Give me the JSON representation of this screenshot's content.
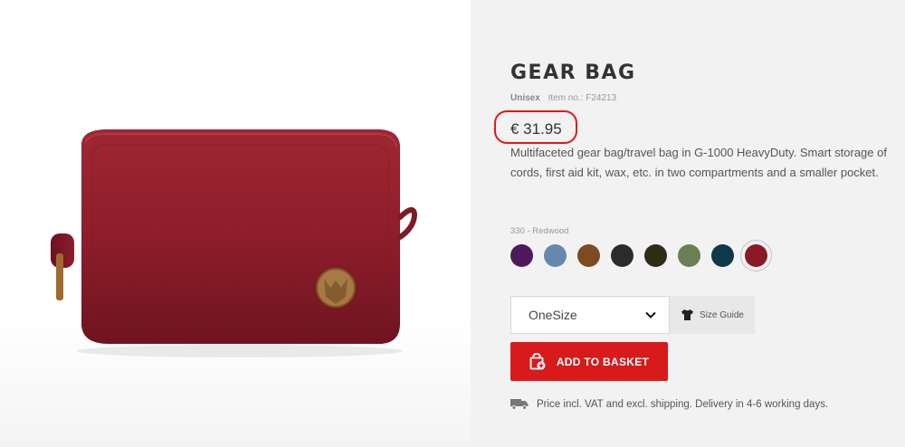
{
  "product": {
    "name": "GEAR BAG",
    "gender": "Unisex",
    "item_no": "Item no.: F24213",
    "price": "€ 31.95",
    "description": "Multifaceted gear bag/travel bag in G-1000 HeavyDuty. Smart storage of cords, first aid kit, wax, etc. in two compartments and a smaller pocket."
  },
  "colors": {
    "selected_label": "330 - Redwood",
    "swatches": [
      {
        "name": "purple",
        "hex": "#4f1a5c"
      },
      {
        "name": "blue",
        "hex": "#6588ab"
      },
      {
        "name": "brown",
        "hex": "#7d4a22"
      },
      {
        "name": "black",
        "hex": "#2b2b2b"
      },
      {
        "name": "dark-olive",
        "hex": "#2e2c16"
      },
      {
        "name": "green",
        "hex": "#6a7f54"
      },
      {
        "name": "navy",
        "hex": "#0f3848"
      },
      {
        "name": "redwood",
        "hex": "#8b1a27",
        "selected": true
      }
    ]
  },
  "size": {
    "value": "OneSize",
    "guide_label": "Size Guide"
  },
  "actions": {
    "basket_label": "ADD TO BASKET"
  },
  "shipping_note": "Price incl. VAT and excl. shipping. Delivery in 4-6 working days.",
  "accent_colors": {
    "button": "#d71a1a",
    "highlight_ring": "#e01919"
  }
}
